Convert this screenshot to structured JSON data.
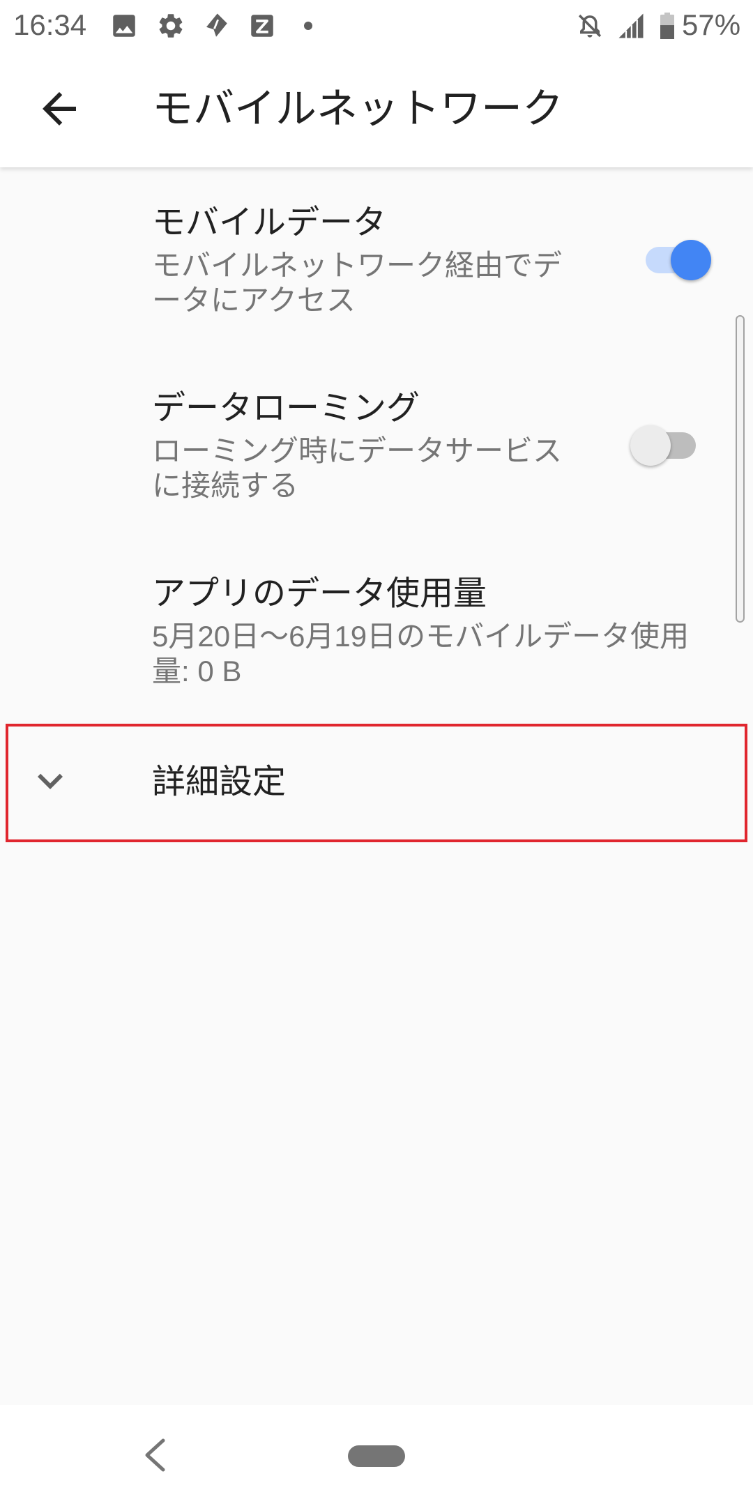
{
  "status_bar": {
    "time": "16:34",
    "battery_percent": "57%",
    "battery_level": 0.57,
    "notification_icons": [
      "image-icon",
      "settings-icon",
      "app-notification-icon",
      "z-app-icon",
      "more-notifications-dot-icon"
    ],
    "system_icons": [
      "notifications-off-icon",
      "cell-signal-icon",
      "battery-icon"
    ]
  },
  "app_bar": {
    "back_icon": "arrow-back-icon",
    "title": "モバイルネットワーク"
  },
  "preferences": [
    {
      "title": "モバイルデータ",
      "summary_lines": [
        "モバイルネットワーク経由でデ",
        "ータにアクセス"
      ],
      "switch_on": true
    },
    {
      "title": "データローミング",
      "summary_lines": [
        "ローミング時にデータサービス",
        "に接続する"
      ],
      "switch_on": false
    },
    {
      "title": "アプリのデータ使用量",
      "summary_lines": [
        "5月20日〜6月19日のモバイルデータ使用",
        "量: 0 B"
      ]
    }
  ],
  "advanced": {
    "icon": "expand-more-icon",
    "label": "詳細設定",
    "highlighted": true
  },
  "navigation_bar": {
    "back_icon": "nav-back-icon",
    "home_icon": "home-pill-icon"
  },
  "colors": {
    "accent": "#4285f4",
    "switch_on_track": "#c6dafc",
    "switch_off_track": "#bdbdbd",
    "switch_off_thumb": "#ececec",
    "highlight_border": "#e0262e",
    "background": "#fafafa",
    "title_text": "#212121",
    "summary_text": "#757575",
    "status_icon": "#5f5f5f"
  }
}
